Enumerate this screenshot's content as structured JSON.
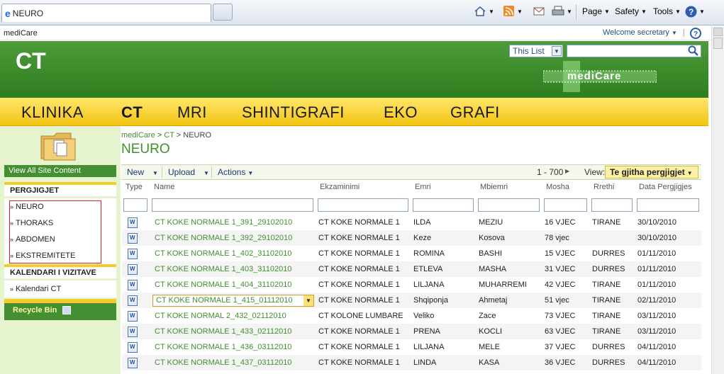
{
  "browser": {
    "tab_title": "NEURO",
    "home_icon": "home-icon",
    "feed_icon": "rss-icon",
    "mail_icon": "mail-icon",
    "print_icon": "print-icon",
    "page": "Page",
    "safety": "Safety",
    "tools": "Tools",
    "help_icon": "help-icon"
  },
  "suite": {
    "site": "mediCare",
    "welcome": "Welcome secretary",
    "help_icon": "help-icon"
  },
  "header": {
    "site_title": "CT",
    "search_scope": "This List",
    "search_placeholder": "",
    "logo_text": "mediCare"
  },
  "topnav": [
    "KLINIKA",
    "CT",
    "MRI",
    "SHINTIGRAFI",
    "EKO",
    "GRAFI"
  ],
  "quicklaunch": {
    "view_all": "View All Site Content",
    "section1": "PERGJIGJET",
    "items1": [
      "NEURO",
      "THORAKS",
      "ABDOMEN",
      "EKSTREMITETE"
    ],
    "section2": "KALENDARI I VIZITAVE",
    "items2": [
      "Kalendari CT"
    ],
    "recycle": "Recycle Bin"
  },
  "breadcrumb": {
    "a": "mediCare",
    "sep": ">",
    "b": "CT",
    "c": "NEURO"
  },
  "page_title": "NEURO",
  "toolbar": {
    "new": "New",
    "upload": "Upload",
    "actions": "Actions",
    "paging": "1 - 700",
    "view_label": "View:",
    "view_value": "Te gjitha pergjigjet"
  },
  "columns": [
    "Type",
    "Name",
    "Ekzaminimi",
    "Emri",
    "Mbiemri",
    "Mosha",
    "Rrethi",
    "Data Pergjigjes"
  ],
  "rows": [
    [
      "CT KOKE NORMALE 1_391_29102010",
      "CT KOKE NORMALE 1",
      "ILDA",
      "MEZIU",
      "16 VJEC",
      "TIRANE",
      "30/10/2010"
    ],
    [
      "CT KOKE NORMALE 1_392_29102010",
      "CT KOKE NORMALE 1",
      "Keze",
      "Kosova",
      "78 vjec",
      "",
      "30/10/2010"
    ],
    [
      "CT KOKE NORMALE 1_402_31102010",
      "CT KOKE NORMALE 1",
      "ROMINA",
      "BASHI",
      "15 VJEC",
      "DURRES",
      "01/11/2010"
    ],
    [
      "CT KOKE NORMALE 1_403_31102010",
      "CT KOKE NORMALE 1",
      "ETLEVA",
      "MASHA",
      "31 VJEC",
      "DURRES",
      "01/11/2010"
    ],
    [
      "CT KOKE NORMALE 1_404_31102010",
      "CT KOKE NORMALE 1",
      "LILJANA",
      "MUHARREMI",
      "42 VJEC",
      "TIRANE",
      "01/11/2010"
    ],
    [
      "CT KOKE NORMALE 1_415_01112010",
      "CT KOKE NORMALE 1",
      "Shqiponja",
      "Ahmetaj",
      "51 vjec",
      "TIRANE",
      "02/11/2010"
    ],
    [
      "CT KOKE NORMAL 2_432_02112010",
      "CT KOLONE LUMBARE",
      "Veliko",
      "Zace",
      "73 VJEC",
      "TIRANE",
      "03/11/2010"
    ],
    [
      "CT KOKE NORMALE 1_433_02112010",
      "CT KOKE NORMALE 1",
      "PRENA",
      "KOCLI",
      "63 VJEC",
      "TIRANE",
      "03/11/2010"
    ],
    [
      "CT KOKE NORMALE 1_436_03112010",
      "CT KOKE NORMALE 1",
      "LILJANA",
      "MELE",
      "37 VJEC",
      "DURRES",
      "04/11/2010"
    ],
    [
      "CT KOKE NORMALE 1_437_03112010",
      "CT KOKE NORMALE 1",
      "LINDA",
      "KASA",
      "36 VJEC",
      "DURRES",
      "04/11/2010"
    ]
  ]
}
